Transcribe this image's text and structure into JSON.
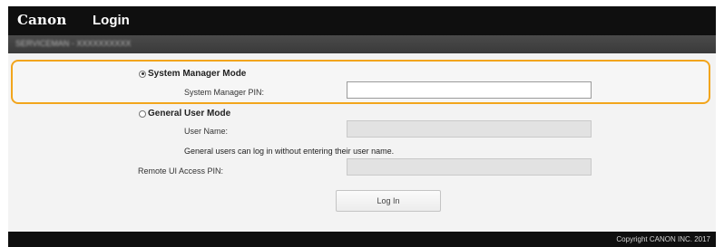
{
  "header": {
    "logo": "Canon",
    "title": "Login",
    "subtitle": "SERVICEMAN - XXXXXXXXXX"
  },
  "system_manager": {
    "mode_label": "System Manager Mode",
    "selected": true,
    "pin_label": "System Manager PIN:",
    "pin_value": ""
  },
  "general_user": {
    "mode_label": "General User Mode",
    "selected": false,
    "user_name_label": "User Name:",
    "user_name_value": "",
    "note": "General users can log in without entering their user name."
  },
  "remote_ui": {
    "pin_label": "Remote UI Access PIN:",
    "pin_value": ""
  },
  "login_button": "Log In",
  "footer": {
    "copyright": "Copyright CANON INC. 2017"
  },
  "colors": {
    "highlight": "#f2a51c",
    "topbar": "#0f0f0f"
  }
}
